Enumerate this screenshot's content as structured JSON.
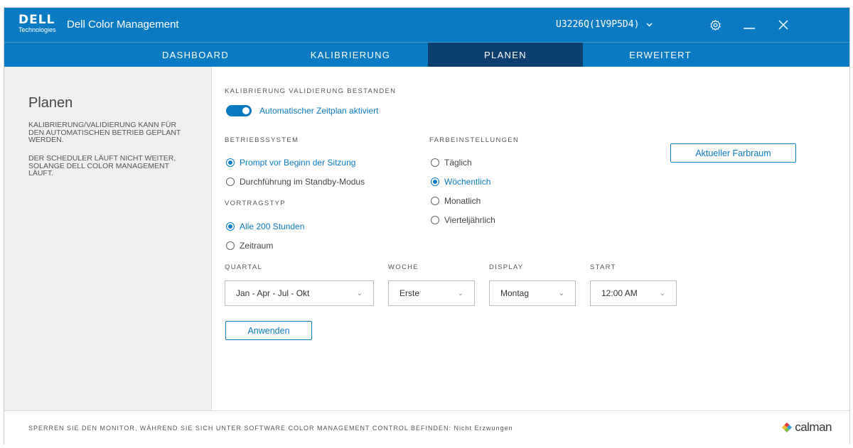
{
  "brand": {
    "logo_main": "DELL",
    "logo_sub": "Technologies",
    "app_title": "Dell Color Management"
  },
  "header": {
    "monitor": "U3226Q(1V9P5D4)"
  },
  "nav": {
    "tabs": [
      "DASHBOARD",
      "KALIBRIERUNG",
      "PLANEN",
      "ERWEITERT"
    ],
    "active": "PLANEN"
  },
  "sidebar": {
    "title": "Planen",
    "text1": "KALIBRIERUNG/VALIDIERUNG KANN FÜR DEN AUTOMATISCHEN BETRIEB GEPLANT WERDEN.",
    "text2": "DER SCHEDULER LÄUFT NICHT WEITER, SOLANGE DELL COLOR MANAGEMENT LÄUFT."
  },
  "main": {
    "status_label": "KALIBRIERUNG VALIDIERUNG BESTANDEN",
    "toggle_label": "Automatischer Zeitplan aktiviert",
    "toggle_on": true,
    "os_label": "BETRIEBSSYSTEM",
    "os_options": [
      "Prompt vor Beginn der Sitzung",
      "Durchführung im Standby-Modus"
    ],
    "os_selected": 0,
    "type_label": "VORTRAGSTYP",
    "type_options": [
      "Alle 200 Stunden",
      "Zeitraum"
    ],
    "type_selected": 0,
    "color_label": "FARBEINSTELLUNGEN",
    "color_options": [
      "Täglich",
      "Wöchentlich",
      "Monatlich",
      "Vierteljährlich"
    ],
    "color_selected": 1,
    "colorspace_button": "Aktueller Farbraum",
    "quarter_label": "QUARTAL",
    "quarter_value": "Jan - Apr - Jul - Okt",
    "week_label": "WOCHE",
    "week_value": "Erste",
    "display_label": "DISPLAY",
    "display_value": "Montag",
    "start_label": "START",
    "start_value": "12:00 AM",
    "apply_button": "Anwenden"
  },
  "footer": {
    "text": "SPERREN SIE DEN MONITOR, WÄHREND SIE SICH UNTER SOFTWARE COLOR MANAGEMENT CONTROL BEFINDEN: Nicht Erzwungen",
    "partner": "calman"
  },
  "colors": {
    "accent": "#0a7bc2",
    "active_tab": "#0c3f6e",
    "panel": "#efefef"
  }
}
